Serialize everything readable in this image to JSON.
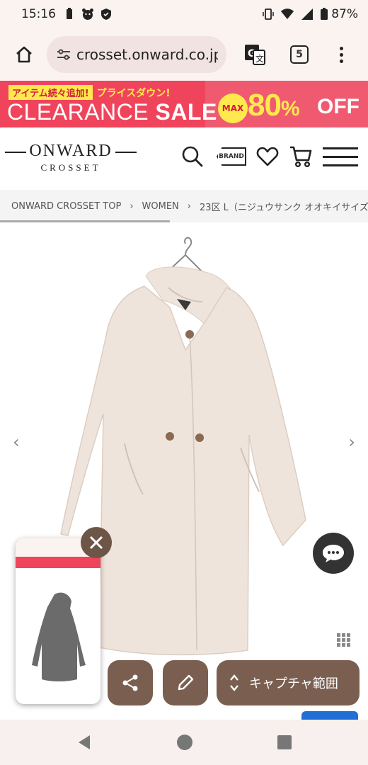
{
  "status_bar": {
    "time": "15:16",
    "battery": "87%"
  },
  "browser": {
    "url": "crosset.onward.co.jp",
    "tab_count": "5"
  },
  "banner": {
    "tag1": "アイテム続々追加!",
    "tag2": "プライスダウン!",
    "clearance": "CLEARANCE",
    "sale": "SALE",
    "max": "MAX",
    "percent": "80",
    "percent_sign": "%",
    "off": "OFF"
  },
  "site_header": {
    "logo_main": "ONWARD",
    "logo_sub": "CROSSET",
    "brand_label": "BRAND"
  },
  "breadcrumb": [
    "ONWARD CROSSET TOP",
    "WOMEN",
    "23区 L（ニジュウサンク オオキイサイズ"
  ],
  "overlay": {
    "capture_label": "キャプチャ範囲"
  },
  "colors": {
    "banner_red": "#f0445c",
    "banner_yellow": "#ffe94d",
    "coat": "#efe4dc",
    "overlay_brown": "#7a5f50"
  }
}
